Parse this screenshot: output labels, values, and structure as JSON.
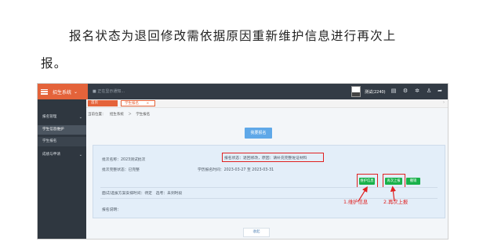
{
  "document": {
    "line1": "报名状态为退回修改需依据原因重新维护信息进行再次上",
    "line2": "报。"
  },
  "app": {
    "system_name": "招生系统",
    "notice_placeholder": "■ 正在显示通知...",
    "username": "测试(2240)",
    "menu": [
      {
        "label": "报名管理",
        "expanded": true
      },
      {
        "label": "学生信息维护"
      },
      {
        "label": "学生报名"
      },
      {
        "label": "成绩与申请"
      }
    ],
    "tabs": [
      {
        "label": "首页"
      },
      {
        "label": "学生报名",
        "close": "×"
      }
    ],
    "breadcrumb": [
      "当前位置：",
      "招生系统",
      "＞",
      "学生报名"
    ],
    "go_enroll_button": "我要报名",
    "panel": {
      "batch_name_label": "批次名称：2023测试批次",
      "status_label": "报名状态：退回修改，原因：请补充完整佐证材料",
      "batch_status_label": "批次完整状态：已完整",
      "batch_time_label": "学历报名时间：2023-03-27 至 2023-03-31",
      "exam_info_label": "面试/选拔方案安排时间：待定　选考：未到时段",
      "reason_label": "报名说明：",
      "buttons": {
        "maintain": "维护信息",
        "resubmit": "再次上报",
        "cancel": "撤销"
      }
    },
    "annotations": {
      "first": "1.维护信息",
      "second": "2.再次上报"
    },
    "bottom_tab": "收起"
  },
  "colors": {
    "accent": "#e4633a",
    "topbar": "#333b45",
    "sidebar": "#2f3740",
    "panel": "#e3eef9",
    "primary_button": "#5fa8e8",
    "success_button": "#19b14a",
    "annotation_red": "#e02020"
  }
}
